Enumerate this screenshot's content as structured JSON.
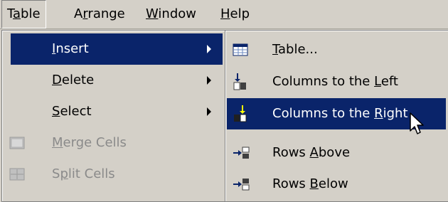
{
  "menubar": {
    "items": [
      {
        "label": "Table",
        "state": "open"
      },
      {
        "label": "Arrange"
      },
      {
        "label": "Window"
      },
      {
        "label": "Help"
      }
    ]
  },
  "table_menu": {
    "items": [
      {
        "label": "Insert",
        "submenu": true,
        "highlighted": true
      },
      {
        "label": "Delete",
        "submenu": true
      },
      {
        "label": "Select",
        "submenu": true
      },
      {
        "label": "Merge Cells",
        "enabled": false,
        "icon": "merge-cells-icon"
      },
      {
        "label": "Split Cells",
        "enabled": false,
        "icon": "split-cells-icon"
      }
    ]
  },
  "insert_submenu": {
    "items": [
      {
        "label": "Table...",
        "icon": "insert-table-icon"
      },
      {
        "label": "Columns to the Left",
        "icon": "insert-columns-left-icon"
      },
      {
        "label": "Columns to the Right",
        "icon": "insert-columns-right-icon",
        "highlighted": true
      },
      {
        "label": "Rows Above",
        "icon": "insert-rows-above-icon"
      },
      {
        "label": "Rows Below",
        "icon": "insert-rows-below-icon"
      }
    ]
  },
  "colors": {
    "menu_background": "#d4d0c8",
    "highlight": "#0a246a",
    "highlight_text": "#ffffff",
    "disabled_text": "#8a8a8a"
  }
}
